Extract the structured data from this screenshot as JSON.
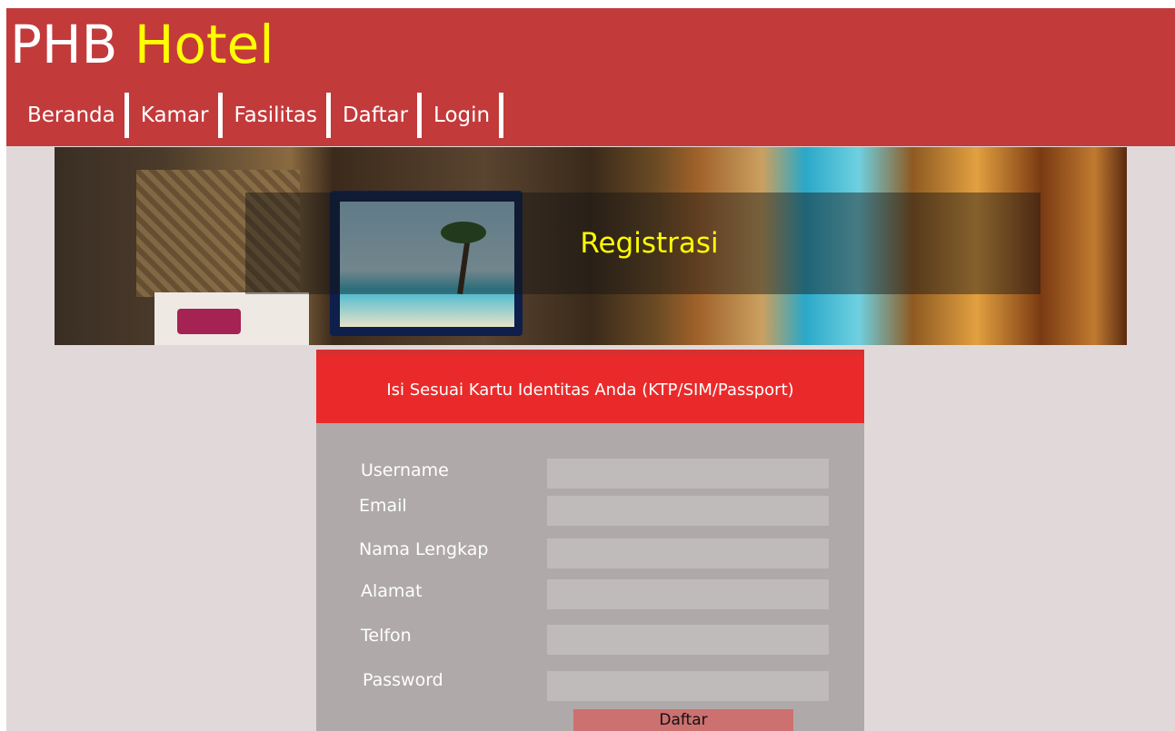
{
  "header": {
    "brand_main": "PHB ",
    "brand_accent": "Hotel",
    "nav": [
      "Beranda",
      "Kamar",
      "Fasilitas",
      "Daftar",
      "Login"
    ]
  },
  "banner": {
    "title": "Registrasi"
  },
  "form": {
    "heading": "Isi Sesuai Kartu Identitas Anda (KTP/SIM/Passport)",
    "fields": [
      {
        "label": "Username",
        "value": ""
      },
      {
        "label": "Email",
        "value": ""
      },
      {
        "label": "Nama Lengkap",
        "value": ""
      },
      {
        "label": "Alamat",
        "value": ""
      },
      {
        "label": "Telfon",
        "value": ""
      },
      {
        "label": "Password",
        "value": ""
      }
    ],
    "submit_label": "Daftar"
  },
  "colors": {
    "header_bg": "#c33a3b",
    "brand_accent": "#ffff00",
    "page_bg": "#e1d9d9",
    "form_header_bg": "#ea2a2a",
    "form_body_bg": "#afa9a9",
    "button_bg": "#cc7070"
  }
}
